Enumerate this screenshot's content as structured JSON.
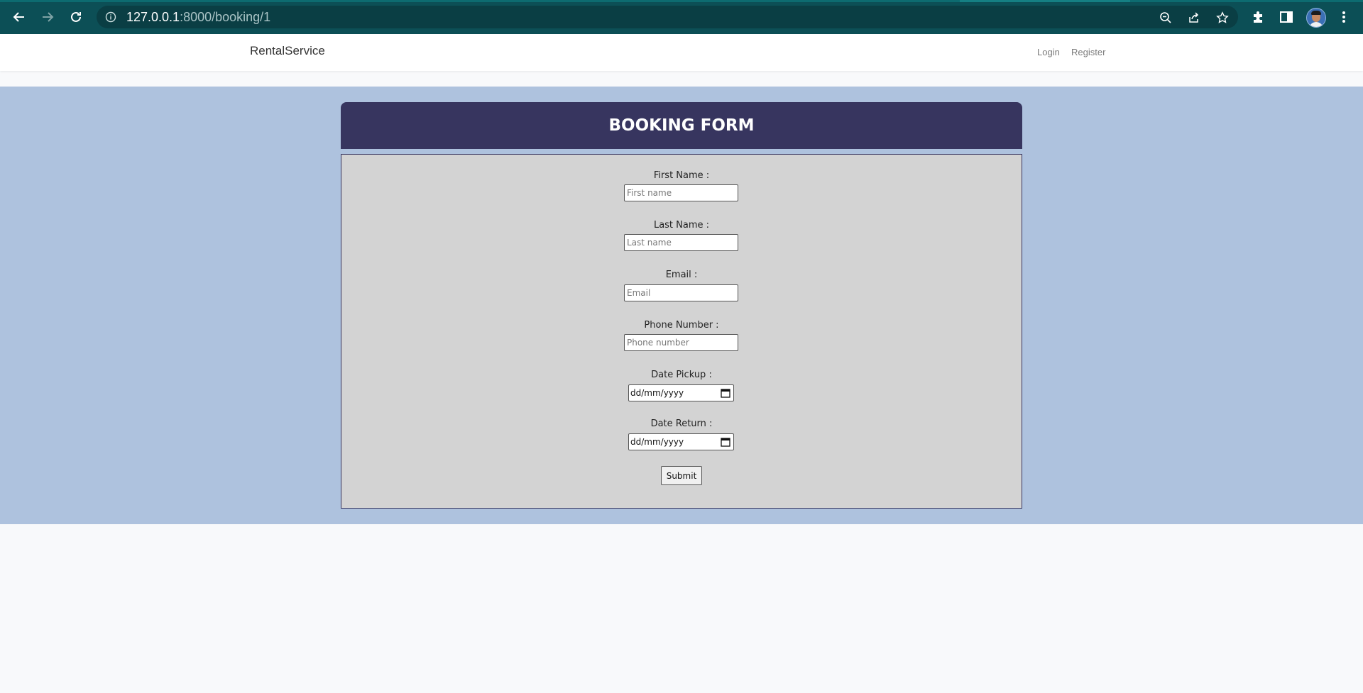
{
  "browser": {
    "url_host": "127.0.0.1",
    "url_rest": ":8000/booking/1",
    "icons": [
      "back-icon",
      "forward-icon",
      "reload-icon",
      "info-icon",
      "zoom-out-icon",
      "share-icon",
      "star-icon",
      "extensions-icon",
      "sidebar-icon",
      "profile-avatar",
      "menu-icon"
    ]
  },
  "navbar": {
    "brand": "RentalService",
    "links": [
      {
        "label": "Login"
      },
      {
        "label": "Register"
      }
    ]
  },
  "form": {
    "title": "BOOKING FORM",
    "fields": [
      {
        "label": "First Name :",
        "placeholder": "First name"
      },
      {
        "label": "Last Name :",
        "placeholder": "Last name"
      },
      {
        "label": "Email :",
        "placeholder": "Email"
      },
      {
        "label": "Phone Number :",
        "placeholder": "Phone number"
      }
    ],
    "date_fields": [
      {
        "label": "Date Pickup :",
        "value": "dd/mm/yyyy"
      },
      {
        "label": "Date Return :",
        "value": "dd/mm/yyyy"
      }
    ],
    "submit_label": "Submit"
  },
  "colors": {
    "chrome": "#0c4f56",
    "band": "#aec2de",
    "header": "#37355f",
    "panel": "#d3d3d3"
  }
}
